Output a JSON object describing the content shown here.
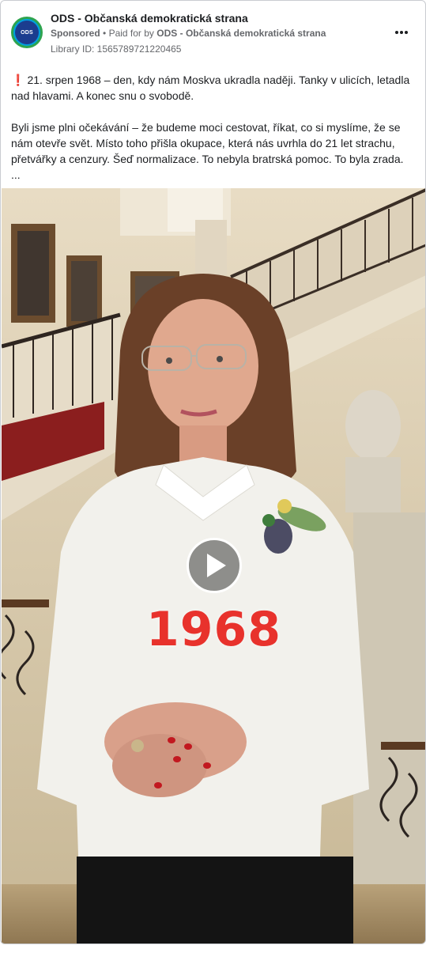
{
  "ad": {
    "page_name": "ODS - Občanská demokratická strana",
    "avatar_text": "ODS",
    "sponsored": "Sponsored",
    "paid_for_prefix": "Paid for by",
    "paid_for_name": "ODS - Občanská demokratická strana",
    "library_id": "Library ID: 1565789721220465",
    "more_icon": "more-dots-icon"
  },
  "body": {
    "para1": "21. srpen 1968 – den, kdy nám Moskva ukradla naději. Tanky v ulicích, letadla nad hlavami. A konec snu o svobodě.",
    "para2": "Byli jsme plni očekávání – že budeme moci cestovat, říkat, co si myslíme, že se nám otevře svět. Místo toho přišla okupace, která nás uvrhla do 21 let strachu, přetvářky a cenzury. Šeď normalizace. To nebyla bratrská pomoc. To byla zrada.",
    "ellipsis": "..."
  },
  "video": {
    "overlay_text": "1968",
    "play_icon": "play-icon"
  },
  "colors": {
    "accent_red": "#e8322c",
    "meta_gray": "#65676b",
    "avatar_blue": "#00a0df"
  }
}
